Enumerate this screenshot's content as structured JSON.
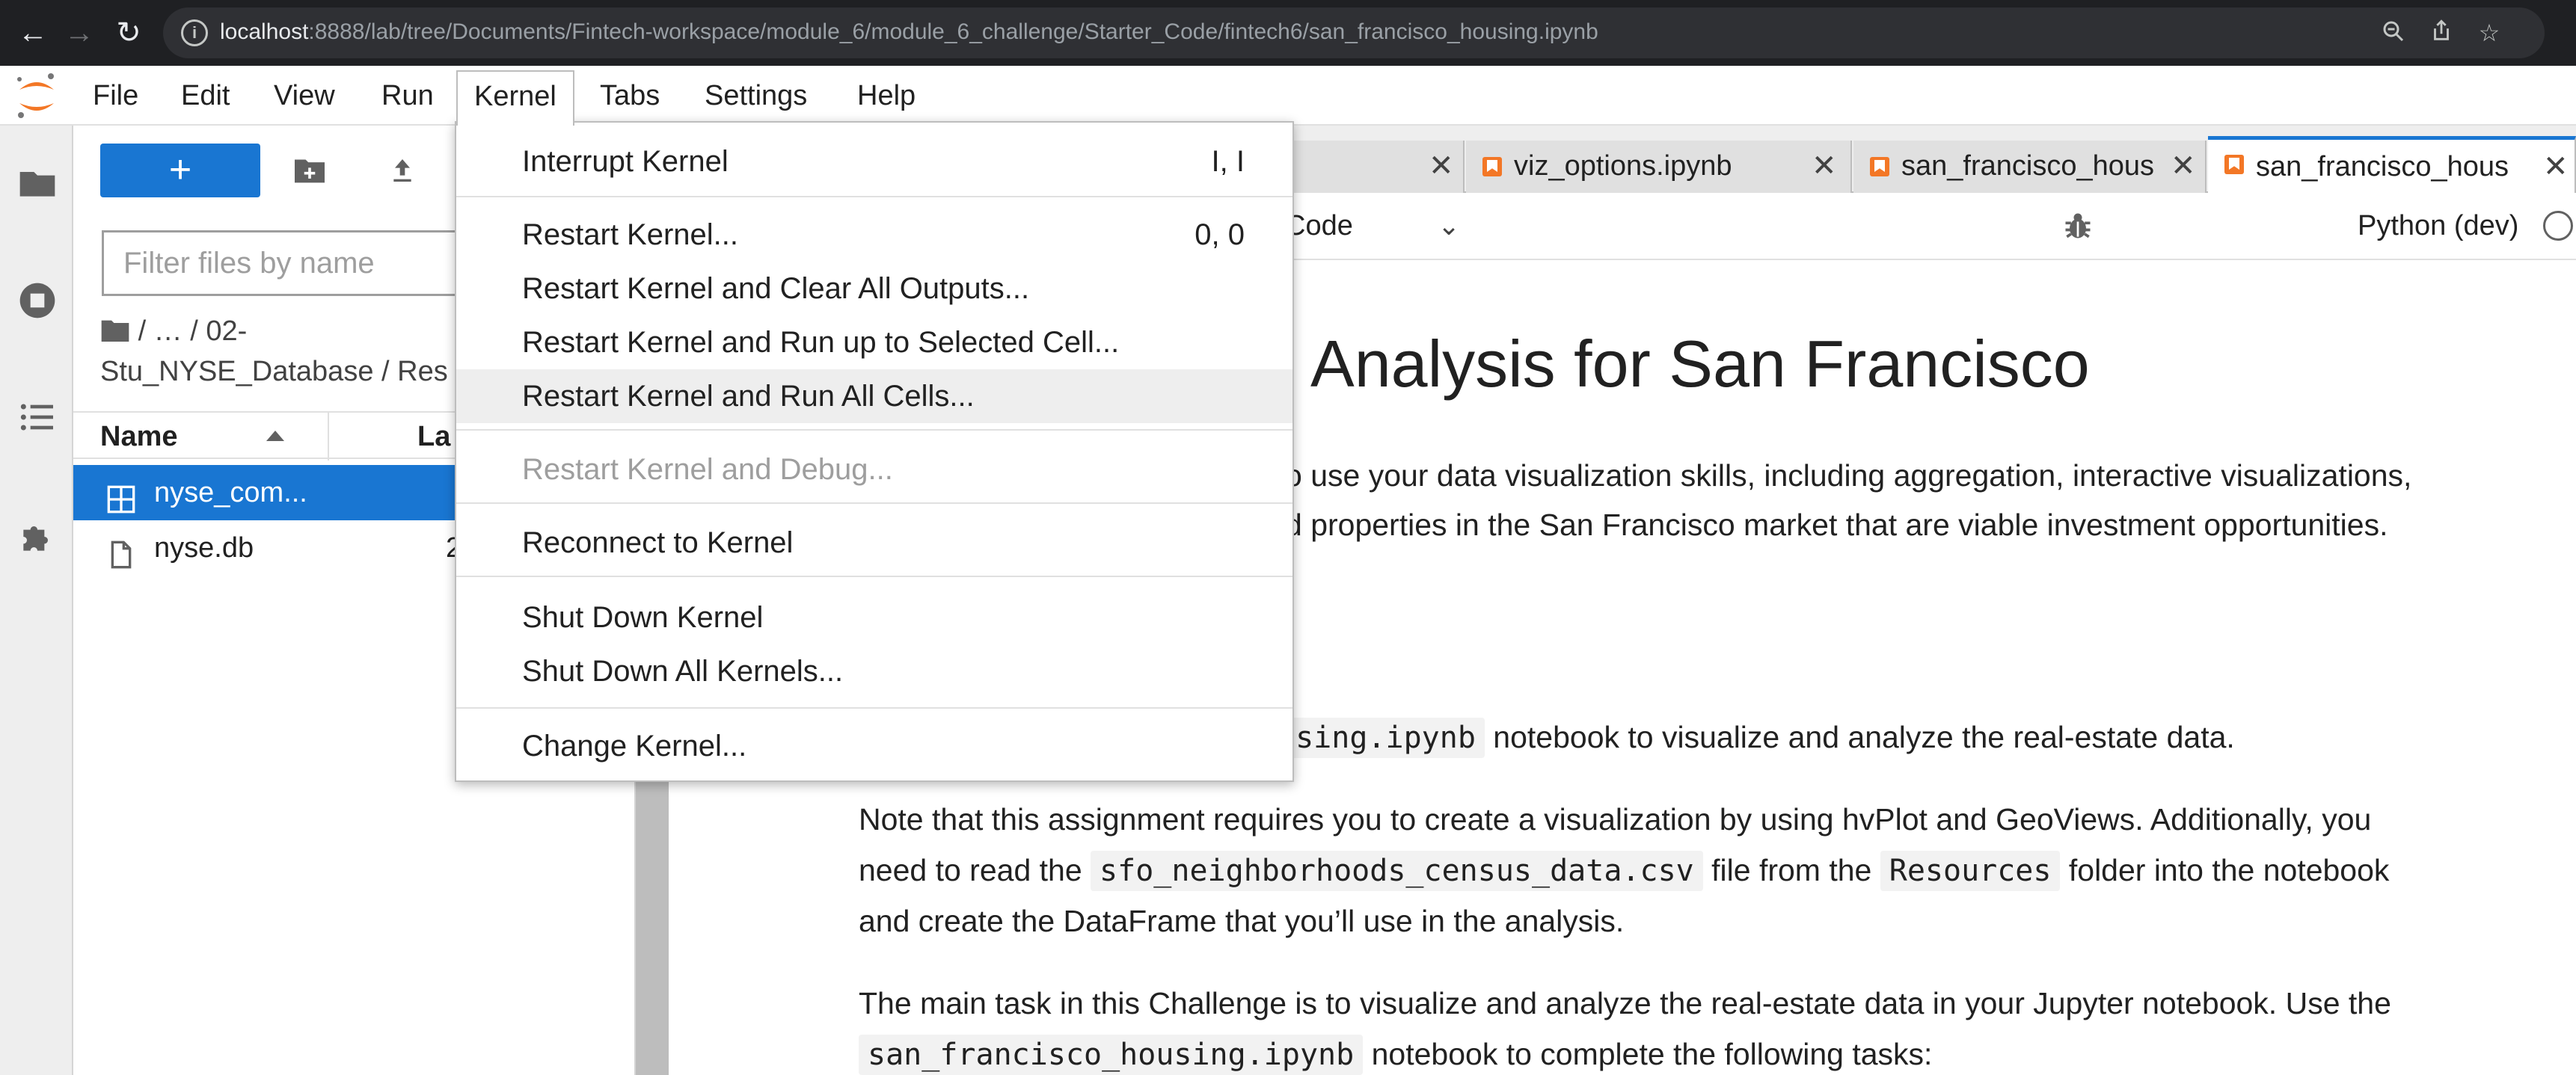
{
  "browser": {
    "url_host": "localhost",
    "url_rest": ":8888/lab/tree/Documents/Fintech-workspace/module_6/module_6_challenge/Starter_Code/fintech6/san_francisco_housing.ipynb"
  },
  "menubar": {
    "items": [
      "File",
      "Edit",
      "View",
      "Run",
      "Kernel",
      "Tabs",
      "Settings",
      "Help"
    ],
    "active": "Kernel"
  },
  "filebrowser": {
    "filter_placeholder": "Filter files by name",
    "breadcrumb_line1": "/   …   / 02-",
    "breadcrumb_line2": "Stu_NYSE_Database / Res",
    "col_name": "Name",
    "col_last_modified": "La",
    "files": [
      {
        "name": "nyse_com...",
        "date": "",
        "selected": true,
        "icon": "table-icon"
      },
      {
        "name": "nyse.db",
        "date": "2",
        "selected": false,
        "icon": "file-icon"
      }
    ]
  },
  "tabs": [
    {
      "label": "",
      "close": "✕"
    },
    {
      "label": "viz_options.ipynb",
      "close": "✕"
    },
    {
      "label": "san_francisco_hous",
      "close": "✕"
    },
    {
      "label": "san_francisco_hous",
      "close": "✕",
      "active": true
    }
  ],
  "toolbar": {
    "cell_type": "Code",
    "kernel_name": "Python (dev)"
  },
  "notebook": {
    "heading": "Analysis for San Francisco",
    "p1_line1": "o use your data visualization skills, including aggregation, interactive visualizations,",
    "p1_line2": "d properties in the San Francisco market that are viable investment opportunities.",
    "p2_code": "using.ipynb",
    "p2_text": " notebook to visualize and analyze the real-estate data.",
    "p3_line1": "Note that this assignment requires you to create a visualization by using hvPlot and GeoViews. Additionally, you",
    "p3_line2_a": "need to read the ",
    "p3_line2_code1": "sfo_neighborhoods_census_data.csv",
    "p3_line2_b": " file from the ",
    "p3_line2_code2": "Resources",
    "p3_line2_c": " folder into the notebook",
    "p3_line3": "and create the DataFrame that you’ll use in the analysis.",
    "p4_line1": "The main task in this Challenge is to visualize and analyze the real-estate data in your Jupyter notebook. Use the",
    "p4_code": "san_francisco_housing.ipynb",
    "p4_text": " notebook to complete the following tasks:"
  },
  "kernel_menu": {
    "items": [
      {
        "label": "Interrupt Kernel",
        "shortcut": "I, I"
      },
      {
        "label": "Restart Kernel...",
        "shortcut": "0, 0"
      },
      {
        "label": "Restart Kernel and Clear All Outputs...",
        "shortcut": ""
      },
      {
        "label": "Restart Kernel and Run up to Selected Cell...",
        "shortcut": ""
      },
      {
        "label": "Restart Kernel and Run All Cells...",
        "shortcut": "",
        "hover": true
      },
      {
        "label": "Restart Kernel and Debug...",
        "shortcut": "",
        "disabled": true
      },
      {
        "label": "Reconnect to Kernel",
        "shortcut": ""
      },
      {
        "label": "Shut Down Kernel",
        "shortcut": ""
      },
      {
        "label": "Shut Down All Kernels...",
        "shortcut": ""
      },
      {
        "label": "Change Kernel...",
        "shortcut": ""
      }
    ]
  },
  "colors": {
    "accent": "#1976d2",
    "notebook_icon": "#f37726"
  }
}
